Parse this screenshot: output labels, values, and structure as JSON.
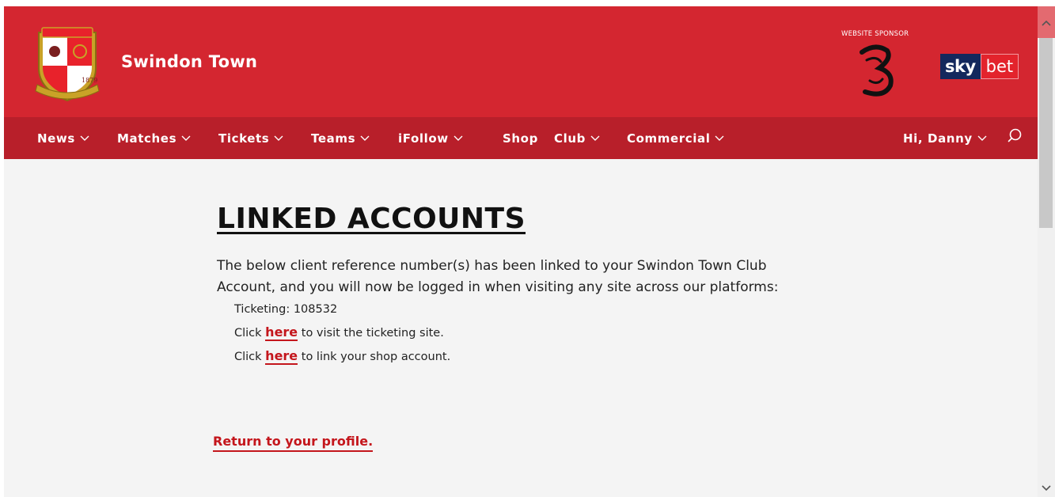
{
  "header": {
    "site_title": "Swindon Town",
    "crest_year": "1879",
    "sponsor_label": "WEBSITE SPONSOR",
    "sponsor_logo_sky": "sky",
    "sponsor_logo_bet": "bet"
  },
  "nav": {
    "items": [
      {
        "label": "News",
        "has_dropdown": true
      },
      {
        "label": "Matches",
        "has_dropdown": true
      },
      {
        "label": "Tickets",
        "has_dropdown": true
      },
      {
        "label": "Teams",
        "has_dropdown": true
      },
      {
        "label": "iFollow",
        "has_dropdown": true
      },
      {
        "label": "Shop",
        "has_dropdown": false
      },
      {
        "label": "Club",
        "has_dropdown": true
      },
      {
        "label": "Commercial",
        "has_dropdown": true
      }
    ],
    "user_greeting": "Hi, Danny"
  },
  "main": {
    "title": "LINKED ACCOUNTS",
    "intro": "The below client reference number(s) has been linked to your Swindon Town Club Account, and you will now be logged in when visiting any site across our platforms:",
    "ticketing_ref": "Ticketing: 108532",
    "ticket_line": {
      "prefix": "Click ",
      "link": "here",
      "suffix": " to visit the ticketing site."
    },
    "shop_line": {
      "prefix": "Click ",
      "link": "here",
      "suffix": " to link your shop account."
    },
    "return_link": "Return to your profile."
  },
  "colors": {
    "header_red": "#d42630",
    "nav_red": "#b81f2a",
    "link_red": "#c4161c",
    "page_bg": "#f4f4f4"
  }
}
